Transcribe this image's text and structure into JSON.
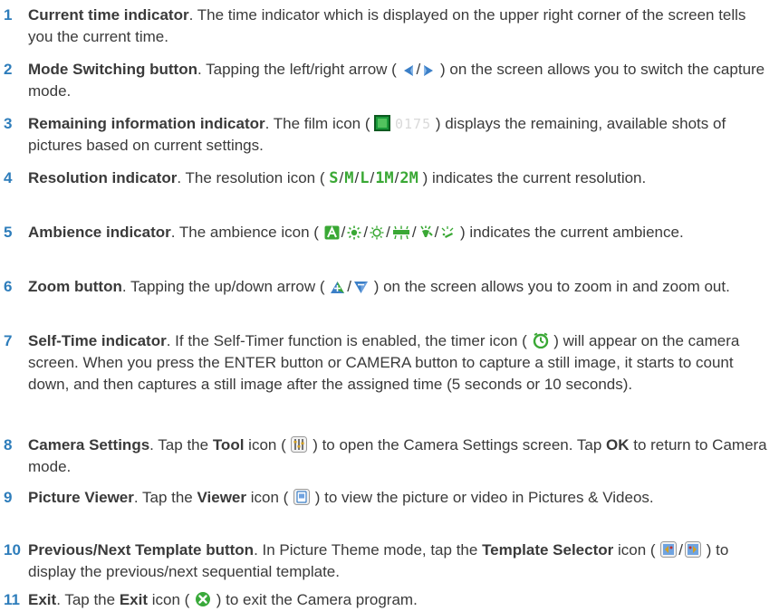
{
  "colors": {
    "number": "#2e7dbb",
    "text": "#3a3a3a",
    "icon_green": "#3aa835",
    "icon_blue": "#3b7fc7",
    "exit_green": "#39a93a"
  },
  "items": [
    {
      "num": "1",
      "term": "Current time indicator",
      "pre": ". The time indicator which is displayed on the upper right corner of the screen tells you the current time."
    },
    {
      "num": "2",
      "term": "Mode Switching button",
      "pre": ". Tapping the left/right arrow ( ",
      "post": " ) on the screen allows you to switch the capture mode.",
      "icons": [
        "left-arrow-icon",
        "right-arrow-icon"
      ]
    },
    {
      "num": "3",
      "term": "Remaining information indicator",
      "pre": ". The film icon ( ",
      "count": "0175",
      "post": " ) displays the remaining, available shots of pictures based on current settings.",
      "icons": [
        "film-icon"
      ]
    },
    {
      "num": "4",
      "term": "Resolution indicator",
      "pre": ". The resolution icon ( ",
      "resolutions": [
        "S",
        "M",
        "L",
        "1M",
        "2M"
      ],
      "post": " ) indicates the current resolution."
    },
    {
      "num": "5",
      "term": "Ambience indicator",
      "pre": ". The ambience icon ( ",
      "post": " ) indicates the current ambience.",
      "icons": [
        "auto-icon",
        "sunny-icon",
        "bright-icon",
        "fluorescent-icon",
        "incandescent-icon",
        "night-icon"
      ]
    },
    {
      "num": "6",
      "term": "Zoom button",
      "pre": ". Tapping the up/down arrow ( ",
      "post": " ) on the screen allows you to zoom in and zoom out.",
      "icons": [
        "up-arrow-icon",
        "down-arrow-icon"
      ]
    },
    {
      "num": "7",
      "term": "Self-Time indicator",
      "pre": ". If the Self-Timer function is enabled, the timer icon ( ",
      "post": " ) will appear on the camera screen. When you press the ENTER button or CAMERA button to capture a still image, it starts to count down, and then captures a still image after the assigned time (5 seconds or 10 seconds).",
      "icons": [
        "timer-icon"
      ]
    },
    {
      "num": "8",
      "term": "Camera Settings",
      "pre": ". Tap the ",
      "bold1": "Tool",
      "mid": " icon ( ",
      "post": " ) to open the Camera Settings screen. Tap ",
      "bold2": "OK",
      "post2": " to return to Camera mode.",
      "icons": [
        "tool-icon"
      ]
    },
    {
      "num": "9",
      "term": "Picture Viewer",
      "pre": ". Tap the ",
      "bold1": "Viewer",
      "mid": " icon ( ",
      "post": " ) to view the picture or video in Pictures & Videos.",
      "icons": [
        "viewer-icon"
      ]
    },
    {
      "num": "10",
      "term": "Previous/Next Template button",
      "pre": ". In Picture Theme mode, tap the ",
      "bold1": "Template Selector",
      "mid": " icon ( ",
      "post": " ) to display the previous/next sequential template.",
      "icons": [
        "template-prev-icon",
        "template-next-icon"
      ]
    },
    {
      "num": "11",
      "term": "Exit",
      "pre": ". Tap the ",
      "bold1": "Exit",
      "mid": " icon ( ",
      "post": " ) to exit the Camera program.",
      "icons": [
        "exit-icon"
      ]
    }
  ]
}
